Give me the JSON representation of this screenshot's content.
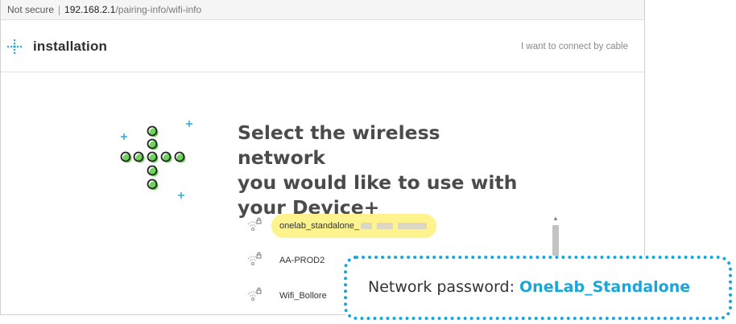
{
  "browser": {
    "security_label": "Not secure",
    "url_host": "192.168.2.1",
    "url_path": "/pairing-info/wifi-info"
  },
  "header": {
    "logo_icon": "dotted-plus-logo-icon",
    "brand": "installation",
    "cable_link": "I want to connect by cable"
  },
  "main": {
    "heading_lines": [
      "Select the wireless network",
      "you would like to use with",
      "your Device+"
    ],
    "networks": [
      {
        "name": "onelab_standalone_",
        "selected": true,
        "icon": "wifi-lock-icon",
        "redacted_suffix": true
      },
      {
        "name": "AA-PROD2",
        "selected": false,
        "icon": "wifi-lock-icon"
      },
      {
        "name": "Wifi_Bollore",
        "selected": false,
        "icon": "wifi-lock-icon"
      }
    ]
  },
  "callout": {
    "label": "Network password: ",
    "password": "OneLab_Standalone"
  },
  "colors": {
    "accent": "#1aa6db",
    "selected_highlight": "#fef38c",
    "illustration_green": "#6ed35b"
  }
}
